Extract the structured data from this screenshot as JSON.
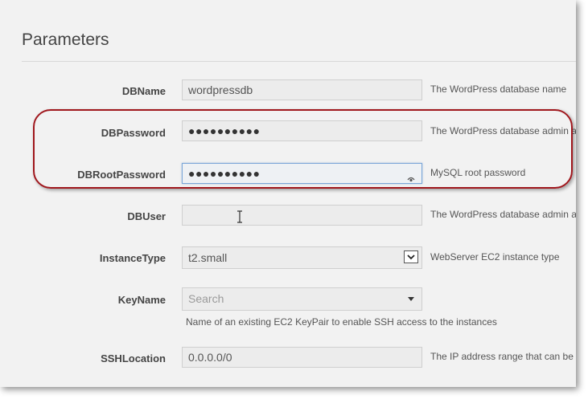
{
  "section": {
    "title": "Parameters"
  },
  "params": {
    "dbname": {
      "label": "DBName",
      "value": "wordpressdb",
      "help": "The WordPress database name"
    },
    "dbpassword": {
      "label": "DBPassword",
      "value": "●●●●●●●●●●",
      "help": "The WordPress database admin a"
    },
    "dbrootpassword": {
      "label": "DBRootPassword",
      "value": "●●●●●●●●●●",
      "help": "MySQL root password"
    },
    "dbuser": {
      "label": "DBUser",
      "value": "",
      "help": "The WordPress database admin a"
    },
    "instancetype": {
      "label": "InstanceType",
      "value": "t2.small",
      "help": "WebServer EC2 instance type"
    },
    "keyname": {
      "label": "KeyName",
      "placeholder": "Search",
      "help": "Name of an existing EC2 KeyPair to enable SSH access to the instances"
    },
    "sshlocation": {
      "label": "SSHLocation",
      "value": "0.0.0.0/0",
      "help": "The IP address range that can be"
    }
  },
  "icons": {
    "reveal_password": "eye-icon",
    "select_arrow": "chevron-down-icon",
    "dropdown_caret": "caret-down-icon",
    "text_cursor": "text-cursor-icon"
  },
  "colors": {
    "highlight_border": "#a0171d",
    "focus_border": "#7aa6d8",
    "background": "#f2f2f2"
  }
}
